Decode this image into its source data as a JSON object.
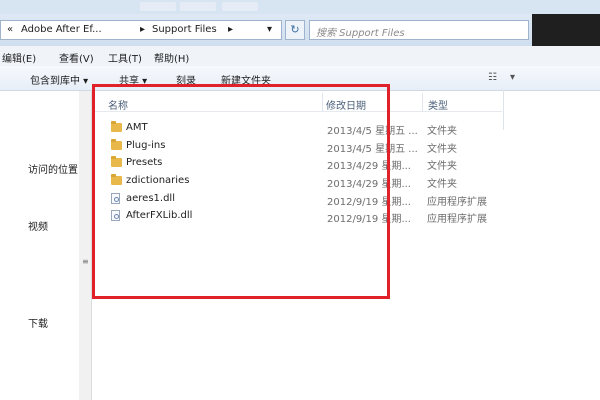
{
  "address": {
    "back_glyph": "«",
    "crumbs": [
      "Adobe After Ef...",
      "Support Files"
    ],
    "crumb_sep": "▸",
    "dropdown": "▾",
    "refresh_icon": "↻"
  },
  "search": {
    "placeholder": "搜索 Support Files"
  },
  "menu": [
    "编辑(E)",
    "查看(V)",
    "工具(T)",
    "帮助(H)"
  ],
  "toolbar": {
    "include_library": "包含到库中 ▾",
    "share": "共享 ▾",
    "burn": "刻录",
    "new_folder": "新建文件夹",
    "view_icon": "☷",
    "view_dropdown": "▾"
  },
  "nav": {
    "recent_places": "访问的位置",
    "videos": "视频",
    "downloads": "下载"
  },
  "columns": {
    "name": "名称",
    "date": "修改日期",
    "type": "类型"
  },
  "files": [
    {
      "name": "AMT",
      "date": "2013/4/5 星期五 ...",
      "type": "文件夹",
      "icon": "folder-icon"
    },
    {
      "name": "Plug-ins",
      "date": "2013/4/5 星期五 ...",
      "type": "文件夹",
      "icon": "folder-icon"
    },
    {
      "name": "Presets",
      "date": "2013/4/29 星期...",
      "type": "文件夹",
      "icon": "folder-icon"
    },
    {
      "name": "zdictionaries",
      "date": "2013/4/29 星期...",
      "type": "文件夹",
      "icon": "folder-icon"
    },
    {
      "name": "aeres1.dll",
      "date": "2012/9/19 星期...",
      "type": "应用程序扩展",
      "icon": "dll-file-icon"
    },
    {
      "name": "AfterFXLib.dll",
      "date": "2012/9/19 星期...",
      "type": "应用程序扩展",
      "icon": "dll-file-icon"
    }
  ],
  "colors": {
    "highlight_box": "#e0212a",
    "folder": "#e8b94a"
  }
}
